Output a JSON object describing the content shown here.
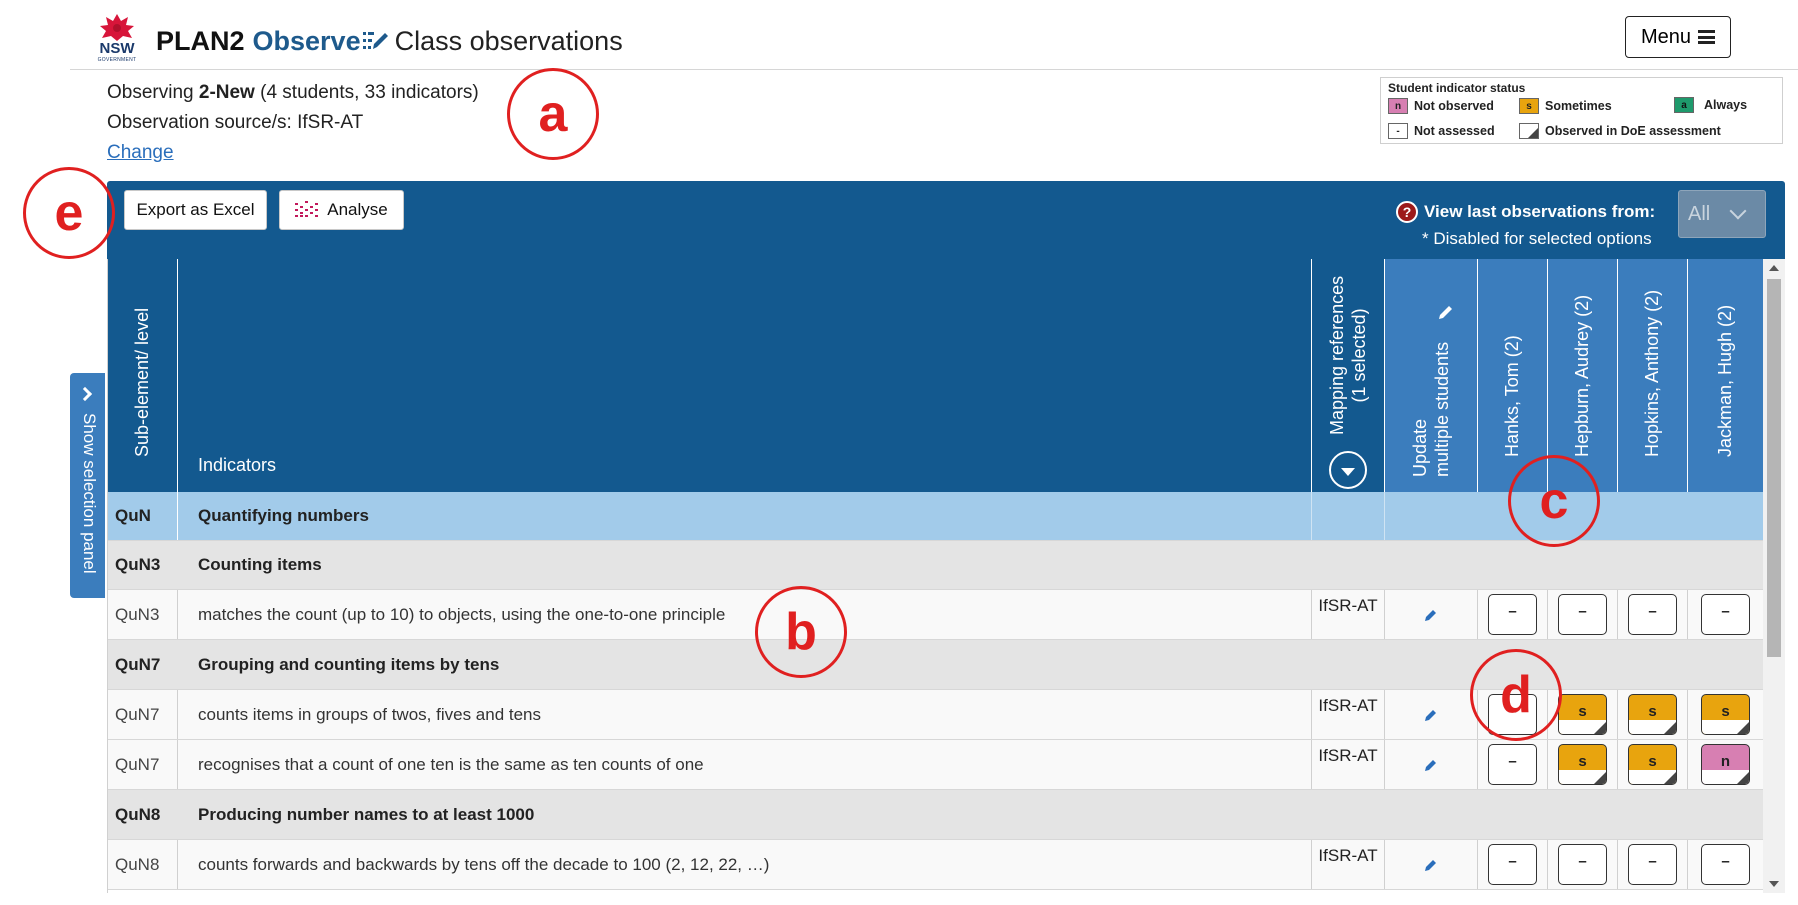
{
  "header": {
    "logo_text": "NSW",
    "logo_subtext": "GOVERNMENT",
    "app_name": "PLAN2",
    "module": "Observe",
    "page_title": "Class observations",
    "menu_label": "Menu"
  },
  "info": {
    "observing_prefix": "Observing ",
    "class_name": "2-New",
    "counts": " (4 students, 33 indicators)",
    "source": "Observation source/s: IfSR-AT",
    "change_label": "Change"
  },
  "legend": {
    "title": "Student indicator status",
    "items": [
      {
        "code": "n",
        "label": "Not observed",
        "color": "#d77fb2"
      },
      {
        "code": "s",
        "label": "Sometimes",
        "color": "#e8a40e"
      },
      {
        "code": "a",
        "label": "Always",
        "color": "#1e9a6c"
      },
      {
        "code": "-",
        "label": "Not assessed",
        "color": "#ffffff"
      },
      {
        "code": "",
        "label": "Observed in DoE assessment",
        "color": "#ffffff"
      }
    ]
  },
  "annotations": [
    "a",
    "b",
    "c",
    "d",
    "e"
  ],
  "toolbar": {
    "export_label": "Export as Excel",
    "analyse_label": "Analyse",
    "view_last_label": "View last observations from:",
    "help_glyph": "?",
    "disabled_note": "* Disabled for selected options",
    "filter_value": "All"
  },
  "side_panel": {
    "label": "Show selection panel"
  },
  "table": {
    "headers": {
      "sub_element": "Sub-element/ level",
      "indicators": "Indicators",
      "mapping_line1": "Mapping references",
      "mapping_line2": "(1 selected)",
      "update_line1": "Update",
      "update_line2": "multiple students"
    },
    "students": [
      "Hanks, Tom (2)",
      "Hepburn, Audrey (2)",
      "Hopkins, Anthony (2)",
      "Jackman, Hugh (2)"
    ],
    "rows": [
      {
        "type": "group",
        "code": "QuN",
        "text": "Quantifying numbers"
      },
      {
        "type": "sub",
        "code": "QuN3",
        "text": "Counting items"
      },
      {
        "type": "item",
        "code": "QuN3",
        "text": "matches the count (up to 10) to objects, using the one-to-one principle",
        "mapping": "IfSR-AT",
        "statuses": [
          "–",
          "–",
          "–",
          "–"
        ]
      },
      {
        "type": "sub",
        "code": "QuN7",
        "text": "Grouping and counting items by tens"
      },
      {
        "type": "item",
        "code": "QuN7",
        "text": "counts items in groups of twos, fives and tens",
        "mapping": "IfSR-AT",
        "statuses": [
          "–",
          "s",
          "s",
          "s"
        ]
      },
      {
        "type": "item",
        "code": "QuN7",
        "text": "recognises that a count of one ten is the same as ten counts of one",
        "mapping": "IfSR-AT",
        "statuses": [
          "–",
          "s",
          "s",
          "n"
        ]
      },
      {
        "type": "sub",
        "code": "QuN8",
        "text": "Producing number names to at least 1000"
      },
      {
        "type": "item",
        "code": "QuN8",
        "text": "counts forwards and backwards by tens off the decade to 100 (2, 12, 22, …)",
        "mapping": "IfSR-AT",
        "statuses": [
          "–",
          "–",
          "–",
          "–"
        ]
      }
    ]
  }
}
